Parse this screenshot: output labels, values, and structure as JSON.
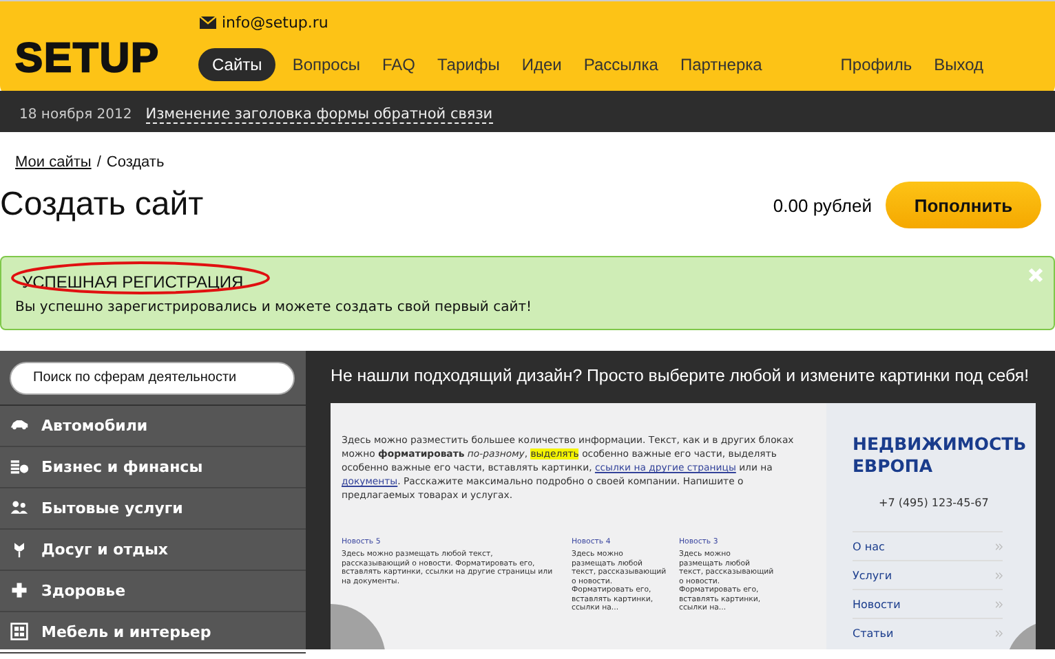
{
  "header": {
    "email": "info@setup.ru",
    "logo": "SETUP",
    "nav": [
      {
        "label": "Сайты",
        "selected": true
      },
      {
        "label": "Вопросы",
        "selected": false
      },
      {
        "label": "FAQ",
        "selected": false
      },
      {
        "label": "Тарифы",
        "selected": false
      },
      {
        "label": "Идеи",
        "selected": false
      },
      {
        "label": "Рассылка",
        "selected": false
      },
      {
        "label": "Партнерка",
        "selected": false
      }
    ],
    "user_links": [
      "Профиль",
      "Выход"
    ]
  },
  "news_bar": {
    "date": "18 ноября 2012",
    "headline": "Изменение заголовка формы обратной связи"
  },
  "breadcrumb": {
    "parent": "Мои сайты",
    "separator": "/",
    "current": "Создать"
  },
  "page": {
    "title": "Создать сайт",
    "balance": "0.00 рублей",
    "topup_button": "Пополнить"
  },
  "alert": {
    "title": "УСПЕШНАЯ РЕГИСТРАЦИЯ",
    "message": "Вы успешно зарегистрировались и можете создать свой первый сайт!",
    "circled": true
  },
  "sidebar": {
    "search_placeholder": "Поиск по сферам деятельности",
    "categories": [
      {
        "label": "Автомобили",
        "kind": "car"
      },
      {
        "label": "Бизнес и финансы",
        "kind": "coins"
      },
      {
        "label": "Бытовые услуги",
        "kind": "people"
      },
      {
        "label": "Досуг и отдых",
        "kind": "flower"
      },
      {
        "label": "Здоровье",
        "kind": "cross"
      },
      {
        "label": "Мебель и интерьер",
        "kind": "cabinet"
      }
    ]
  },
  "promo": {
    "heading": "Не нашли подходящий дизайн? Просто выберите любой и измените картинки под себя!"
  },
  "template_preview": {
    "paragraph": [
      {
        "kind": "plain",
        "text": "Здесь можно разместить большее количество информации. Текст, как и в других блоках можно "
      },
      {
        "kind": "bold",
        "text": "форматировать"
      },
      {
        "kind": "italic",
        "text": " по-разному"
      },
      {
        "kind": "plain",
        "text": ", "
      },
      {
        "kind": "highlight",
        "text": "выделять"
      },
      {
        "kind": "plain",
        "text": " особенно важные его части, выделять особенно важные его части, вставлять картинки, "
      },
      {
        "kind": "link",
        "text": "ссылки на другие страницы"
      },
      {
        "kind": "plain",
        "text": " или на "
      },
      {
        "kind": "link",
        "text": "документы"
      },
      {
        "kind": "plain",
        "text": ". Расскажите максимально подробно о своей компании. Напишите о предлагаемых товарах и услугах."
      }
    ],
    "news": [
      {
        "title": "Новость 5",
        "text": "Здесь можно размещать любой текст, рассказывающий о новости. Форматировать его, вставлять картинки, ссылки на другие страницы или на документы."
      },
      {
        "title": "Новость 4",
        "text": "Здесь можно размещать любой текст, рассказывающий о новости. Форматировать его, вставлять картинки, ссылки на..."
      },
      {
        "title": "Новость 3",
        "text": "Здесь можно размещать любой текст, рассказывающий о новости. Форматировать его, вставлять картинки, ссылки на..."
      }
    ],
    "brand": "НЕДВИЖИМОСТЬ ЕВРОПА",
    "phone": "+7 (495) 123-45-67",
    "menu": [
      "О нас",
      "Услуги",
      "Новости",
      "Статьи"
    ]
  }
}
